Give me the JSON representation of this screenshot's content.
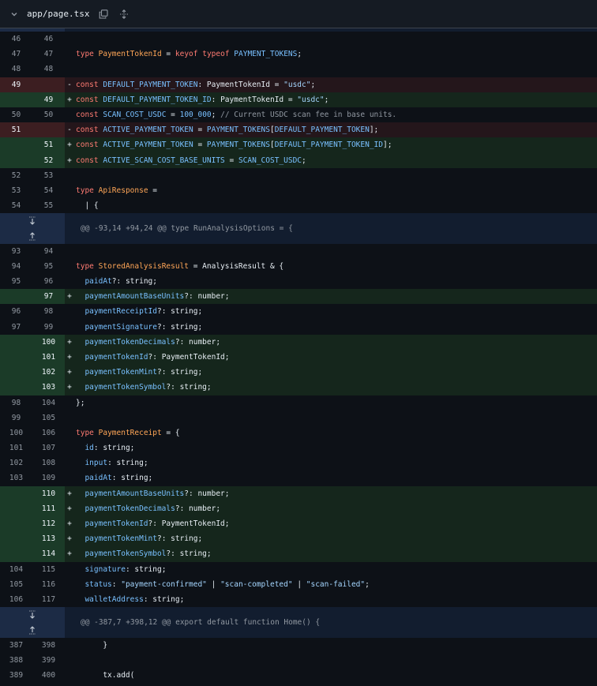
{
  "file": {
    "name": "app/page.tsx"
  },
  "icons": {
    "collapse": "chevron-down-icon",
    "copy": "copy-icon",
    "expand": "unfold-icon"
  },
  "colors": {
    "added": "#1b3b28",
    "removed": "#3c1e21",
    "hunk": "#1c2b45"
  },
  "hunks": [
    "@@ -93,14 +94,24 @@ type RunAnalysisOptions = {",
    "@@ -387,7 +398,12 @@ export default function Home() {"
  ],
  "lines": [
    {
      "old": "46",
      "new": "46",
      "code": ""
    },
    {
      "old": "47",
      "new": "47",
      "code": "type PaymentTokenId = keyof typeof PAYMENT_TOKENS;"
    },
    {
      "old": "48",
      "new": "48",
      "code": ""
    },
    {
      "old": "49",
      "new": "",
      "code": "const DEFAULT_PAYMENT_TOKEN: PaymentTokenId = \"usdc\";"
    },
    {
      "old": "",
      "new": "49",
      "code": "const DEFAULT_PAYMENT_TOKEN_ID: PaymentTokenId = \"usdc\";"
    },
    {
      "old": "50",
      "new": "50",
      "code": "const SCAN_COST_USDC = 100_000; // Current USDC scan fee in base units."
    },
    {
      "old": "51",
      "new": "",
      "code": "const ACTIVE_PAYMENT_TOKEN = PAYMENT_TOKENS[DEFAULT_PAYMENT_TOKEN];"
    },
    {
      "old": "",
      "new": "51",
      "code": "const ACTIVE_PAYMENT_TOKEN = PAYMENT_TOKENS[DEFAULT_PAYMENT_TOKEN_ID];"
    },
    {
      "old": "",
      "new": "52",
      "code": "const ACTIVE_SCAN_COST_BASE_UNITS = SCAN_COST_USDC;"
    },
    {
      "old": "52",
      "new": "53",
      "code": ""
    },
    {
      "old": "53",
      "new": "54",
      "code": "type ApiResponse ="
    },
    {
      "old": "54",
      "new": "55",
      "code": "  | {"
    },
    {
      "old": "93",
      "new": "94",
      "code": ""
    },
    {
      "old": "94",
      "new": "95",
      "code": "type StoredAnalysisResult = AnalysisResult & {"
    },
    {
      "old": "95",
      "new": "96",
      "code": "  paidAt?: string;"
    },
    {
      "old": "",
      "new": "97",
      "code": "  paymentAmountBaseUnits?: number;"
    },
    {
      "old": "96",
      "new": "98",
      "code": "  paymentReceiptId?: string;"
    },
    {
      "old": "97",
      "new": "99",
      "code": "  paymentSignature?: string;"
    },
    {
      "old": "",
      "new": "100",
      "code": "  paymentTokenDecimals?: number;"
    },
    {
      "old": "",
      "new": "101",
      "code": "  paymentTokenId?: PaymentTokenId;"
    },
    {
      "old": "",
      "new": "102",
      "code": "  paymentTokenMint?: string;"
    },
    {
      "old": "",
      "new": "103",
      "code": "  paymentTokenSymbol?: string;"
    },
    {
      "old": "98",
      "new": "104",
      "code": "};"
    },
    {
      "old": "99",
      "new": "105",
      "code": ""
    },
    {
      "old": "100",
      "new": "106",
      "code": "type PaymentReceipt = {"
    },
    {
      "old": "101",
      "new": "107",
      "code": "  id: string;"
    },
    {
      "old": "102",
      "new": "108",
      "code": "  input: string;"
    },
    {
      "old": "103",
      "new": "109",
      "code": "  paidAt: string;"
    },
    {
      "old": "",
      "new": "110",
      "code": "  paymentAmountBaseUnits?: number;"
    },
    {
      "old": "",
      "new": "111",
      "code": "  paymentTokenDecimals?: number;"
    },
    {
      "old": "",
      "new": "112",
      "code": "  paymentTokenId?: PaymentTokenId;"
    },
    {
      "old": "",
      "new": "113",
      "code": "  paymentTokenMint?: string;"
    },
    {
      "old": "",
      "new": "114",
      "code": "  paymentTokenSymbol?: string;"
    },
    {
      "old": "104",
      "new": "115",
      "code": "  signature: string;"
    },
    {
      "old": "105",
      "new": "116",
      "code": "  status: \"payment-confirmed\" | \"scan-completed\" | \"scan-failed\";"
    },
    {
      "old": "106",
      "new": "117",
      "code": "  walletAddress: string;"
    },
    {
      "old": "387",
      "new": "398",
      "code": "      }"
    },
    {
      "old": "388",
      "new": "399",
      "code": ""
    },
    {
      "old": "389",
      "new": "400",
      "code": "      tx.add("
    }
  ]
}
